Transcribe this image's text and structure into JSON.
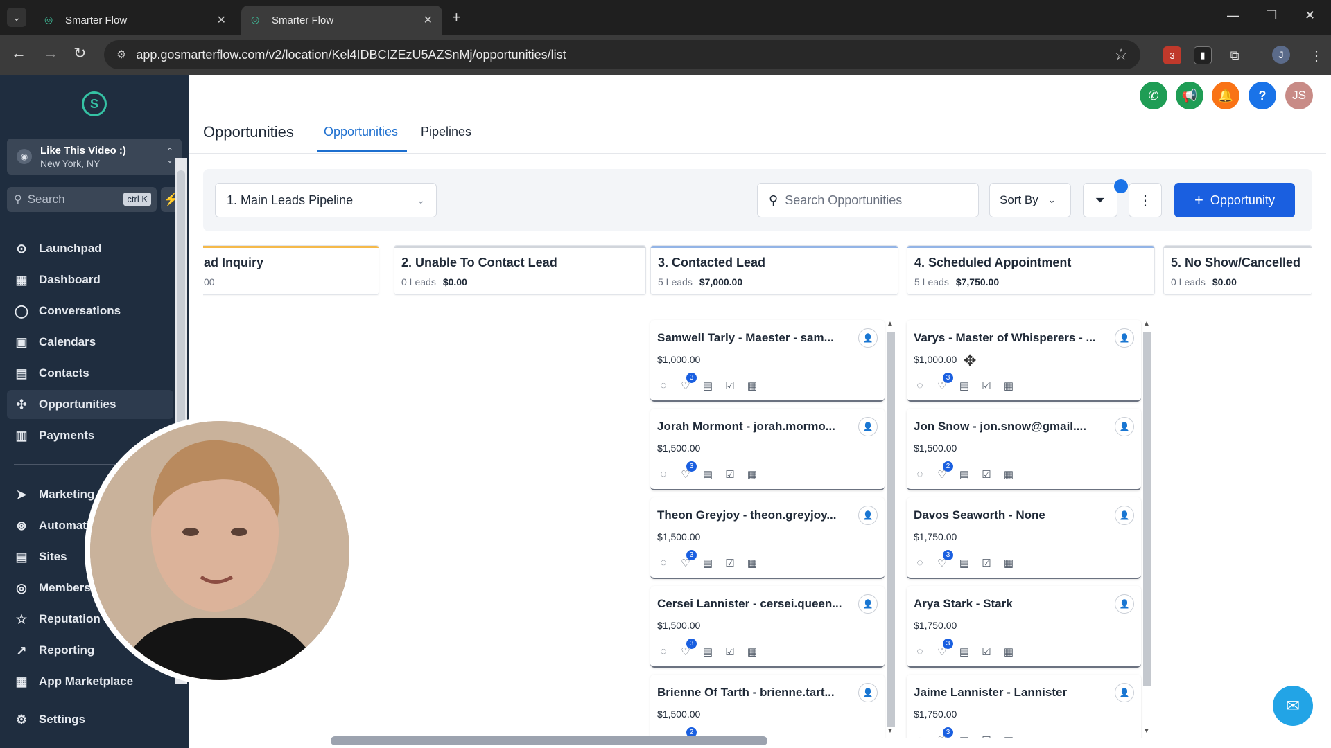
{
  "browser": {
    "tabs": [
      {
        "title": "Smarter Flow",
        "active": false
      },
      {
        "title": "Smarter Flow",
        "active": true
      }
    ],
    "url": "app.gosmarterflow.com/v2/location/Kel4IDBCIZEzU5AZSnMj/opportunities/list",
    "profile_initial": "J",
    "extension_badge": "3"
  },
  "sidebar": {
    "location_name": "Like This Video :)",
    "location_city": "New York, NY",
    "search_placeholder": "Search",
    "search_shortcut": "ctrl K",
    "items": [
      {
        "label": "Launchpad",
        "icon": "rocket-icon"
      },
      {
        "label": "Dashboard",
        "icon": "grid-icon"
      },
      {
        "label": "Conversations",
        "icon": "chat-icon"
      },
      {
        "label": "Calendars",
        "icon": "calendar-icon"
      },
      {
        "label": "Contacts",
        "icon": "contacts-icon"
      },
      {
        "label": "Opportunities",
        "icon": "opportunities-icon"
      },
      {
        "label": "Payments",
        "icon": "payments-icon"
      },
      {
        "label": "Marketing",
        "icon": "send-icon"
      },
      {
        "label": "Automation",
        "icon": "automation-icon"
      },
      {
        "label": "Sites",
        "icon": "sites-icon"
      },
      {
        "label": "Memberships",
        "icon": "membership-icon"
      },
      {
        "label": "Reputation",
        "icon": "star-icon"
      },
      {
        "label": "Reporting",
        "icon": "chart-icon"
      },
      {
        "label": "App Marketplace",
        "icon": "grid-icon"
      },
      {
        "label": "Settings",
        "icon": "gear-icon"
      }
    ],
    "active_item": "Opportunities"
  },
  "header": {
    "avatar_initials": "JS",
    "page_title": "Opportunities",
    "tabs": [
      "Opportunities",
      "Pipelines"
    ],
    "active_tab": "Opportunities"
  },
  "toolbar": {
    "pipeline": "1. Main Leads Pipeline",
    "search_placeholder": "Search Opportunities",
    "sort_label": "Sort By",
    "add_label": "Opportunity"
  },
  "stages": [
    {
      "title": "ad Inquiry",
      "count": "",
      "value": "00",
      "accent": "#f5b94a"
    },
    {
      "title": "2. Unable To Contact Lead",
      "count": "0 Leads",
      "value": "$0.00",
      "accent": "#d1d5db"
    },
    {
      "title": "3. Contacted Lead",
      "count": "5 Leads",
      "value": "$7,000.00",
      "accent": "#93b4e6"
    },
    {
      "title": "4. Scheduled Appointment",
      "count": "5 Leads",
      "value": "$7,750.00",
      "accent": "#93b4e6"
    },
    {
      "title": "5. No Show/Cancelled",
      "count": "0 Leads",
      "value": "$0.00",
      "accent": "#d1d5db"
    }
  ],
  "cards": {
    "contacted": [
      {
        "title": "Samwell Tarly - Maester - sam...",
        "value": "$1,000.00",
        "tasks": "3"
      },
      {
        "title": "Jorah Mormont - jorah.mormo...",
        "value": "$1,500.00",
        "tasks": "3"
      },
      {
        "title": "Theon Greyjoy - theon.greyjoy...",
        "value": "$1,500.00",
        "tasks": "3"
      },
      {
        "title": "Cersei Lannister - cersei.queen...",
        "value": "$1,500.00",
        "tasks": "3"
      },
      {
        "title": "Brienne Of Tarth - brienne.tart...",
        "value": "$1,500.00",
        "tasks": "2"
      }
    ],
    "scheduled": [
      {
        "title": "Varys - Master of Whisperers - ...",
        "value": "$1,000.00",
        "tasks": "3"
      },
      {
        "title": "Jon Snow - jon.snow@gmail....",
        "value": "$1,500.00",
        "tasks": "2"
      },
      {
        "title": "Davos Seaworth - None",
        "value": "$1,750.00",
        "tasks": "3"
      },
      {
        "title": "Arya Stark - Stark",
        "value": "$1,750.00",
        "tasks": "3"
      },
      {
        "title": "Jaime Lannister - Lannister",
        "value": "$1,750.00",
        "tasks": "3"
      }
    ]
  },
  "colors": {
    "sidebar_bg": "#1f2d3f",
    "accent_blue": "#1a5fe0",
    "brand_green": "#35c2a4"
  }
}
